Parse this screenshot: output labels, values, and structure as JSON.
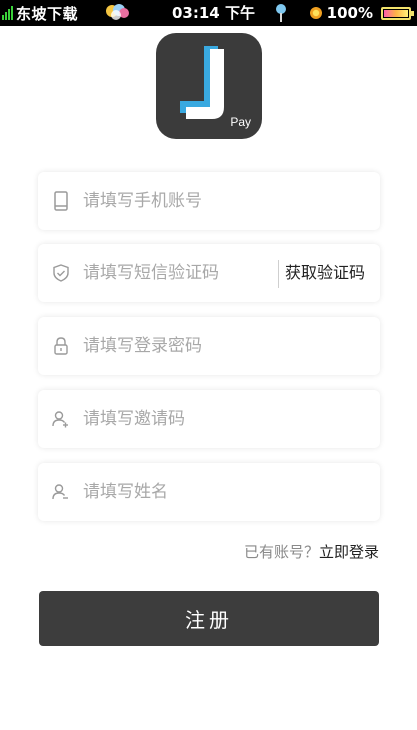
{
  "status_bar": {
    "carrier": "东坡下载",
    "time": "03:14 下午",
    "battery": "100%",
    "icons": [
      "signal-icon",
      "balloon-icon",
      "location-pin-icon",
      "brightness-icon",
      "battery-icon"
    ]
  },
  "logo": {
    "letter": "J",
    "sub": "Pay"
  },
  "form": {
    "phone": {
      "placeholder": "请填写手机账号",
      "value": ""
    },
    "sms": {
      "placeholder": "请填写短信验证码",
      "value": "",
      "get_code": "获取验证码"
    },
    "password": {
      "placeholder": "请填写登录密码",
      "value": ""
    },
    "invite": {
      "placeholder": "请填写邀请码",
      "value": ""
    },
    "name": {
      "placeholder": "请填写姓名",
      "value": ""
    }
  },
  "login": {
    "hint": "已有账号？",
    "link": "立即登录"
  },
  "submit_label": "注册",
  "colors": {
    "button_bg": "#3d3d3d",
    "logo_bg": "#3b3b3b",
    "logo_accent": "#39a9e0",
    "placeholder": "#a8a8a8"
  }
}
